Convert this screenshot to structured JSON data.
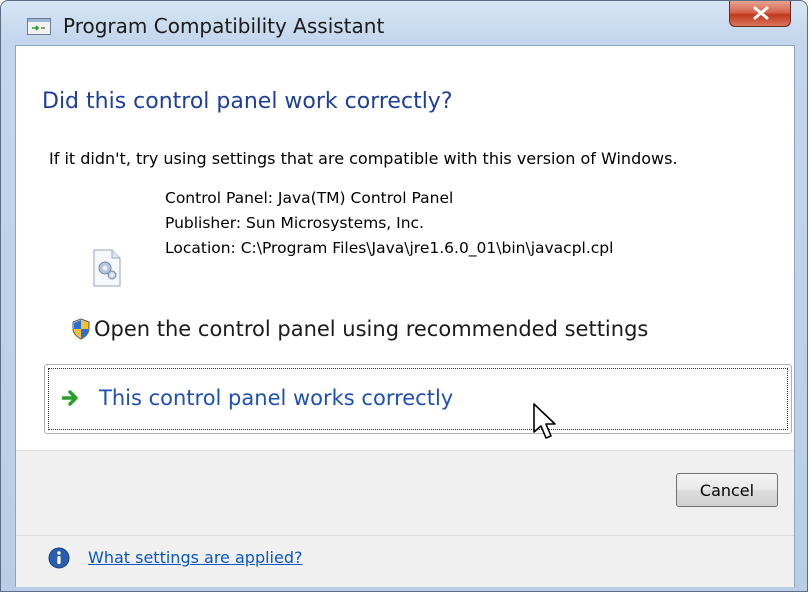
{
  "window": {
    "title": "Program Compatibility Assistant",
    "close_label": "X"
  },
  "dialog": {
    "heading": "Did this control panel work correctly?",
    "instruction": "If it didn't, try using settings that are compatible with this version of Windows.",
    "details": {
      "control_panel": "Control Panel: Java(TM) Control Panel",
      "publisher": "Publisher: Sun Microsystems, Inc.",
      "location": "Location: C:\\Program Files\\Java\\jre1.6.0_01\\bin\\javacpl.cpl"
    },
    "options": [
      {
        "label": "Open the control panel using recommended settings",
        "icon": "uac-shield-icon"
      },
      {
        "label": "This control panel works correctly",
        "icon": "green-arrow-icon"
      }
    ]
  },
  "footer": {
    "cancel_label": "Cancel",
    "help_link": "What settings are applied?",
    "help_icon": "info-icon"
  },
  "colors": {
    "heading": "#1e3e9c",
    "link": "#0a57c2",
    "accent_green": "#2aa02a",
    "close_red": "#c13a1d"
  }
}
